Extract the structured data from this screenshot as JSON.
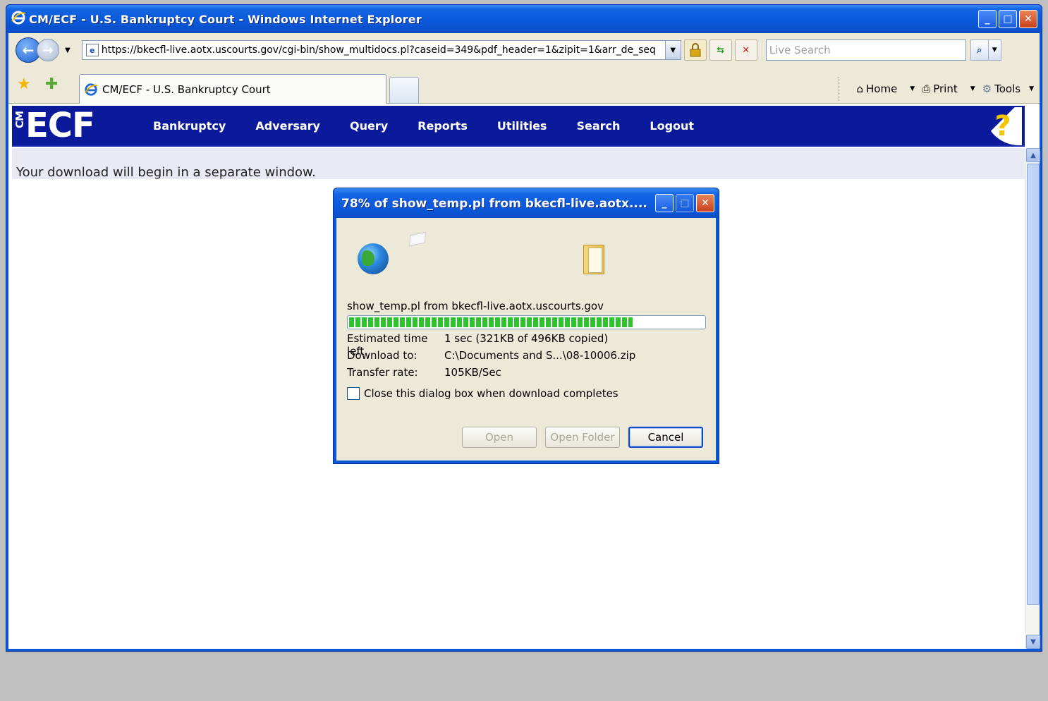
{
  "window": {
    "title": "CM/ECF - U.S. Bankruptcy Court - Windows Internet Explorer",
    "min": "_",
    "max": "□",
    "close": "✕"
  },
  "address_bar": {
    "url": "https://bkecfl-live.aotx.uscourts.gov/cgi-bin/show_multidocs.pl?caseid=349&pdf_header=1&zipit=1&arr_de_seq",
    "search_placeholder": "Live Search"
  },
  "tabs": {
    "active_label": "CM/ECF - U.S. Bankruptcy Court"
  },
  "command_bar": {
    "home": "Home",
    "print": "Print",
    "tools": "Tools"
  },
  "ecf": {
    "logo_main": "ECF",
    "logo_side": "CM",
    "menu": [
      "Bankruptcy",
      "Adversary",
      "Query",
      "Reports",
      "Utilities",
      "Search",
      "Logout"
    ],
    "help": "?",
    "message": "Your download will begin in a separate window."
  },
  "download_dialog": {
    "title": "78% of show_temp.pl from bkecfl-live.aotx....",
    "source": "show_temp.pl from bkecfl-live.aotx.uscourts.gov",
    "progress_fraction": 0.8,
    "time_left_label": "Estimated time left",
    "time_left_value": "1 sec (321KB of 496KB copied)",
    "download_to_label": "Download to:",
    "download_to_value": "C:\\Documents and S...\\08-10006.zip",
    "transfer_rate_label": "Transfer rate:",
    "transfer_rate_value": "105KB/Sec",
    "close_checkbox_label": "Close this dialog box when download completes",
    "close_checkbox_checked": false,
    "buttons": {
      "open": "Open",
      "open_folder": "Open Folder",
      "cancel": "Cancel"
    }
  },
  "colors": {
    "xp_blue": "#0a58d8",
    "ecf_nav": "#0a1a9a",
    "progress_green": "#2ec42e"
  }
}
